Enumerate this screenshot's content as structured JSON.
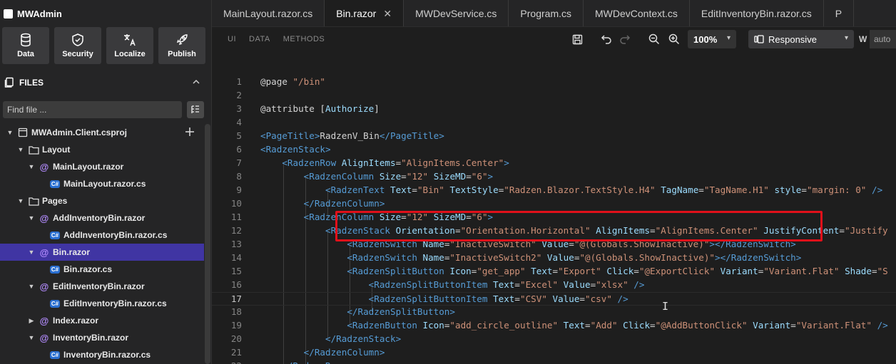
{
  "app": {
    "title": "MWAdmin"
  },
  "quick_actions": [
    {
      "label": "Data",
      "icon": "database-icon"
    },
    {
      "label": "Security",
      "icon": "shield-icon"
    },
    {
      "label": "Localize",
      "icon": "translate-icon"
    },
    {
      "label": "Publish",
      "icon": "rocket-icon"
    }
  ],
  "files": {
    "header": "FILES",
    "search_placeholder": "Find file ...",
    "tree": [
      {
        "label": "MWAdmin.Client.csproj",
        "type": "project",
        "expanded": true,
        "indent": 0
      },
      {
        "label": "Layout",
        "type": "folder",
        "expanded": true,
        "indent": 1
      },
      {
        "label": "MainLayout.razor",
        "type": "razor",
        "expanded": true,
        "indent": 2
      },
      {
        "label": "MainLayout.razor.cs",
        "type": "cs",
        "indent": 3
      },
      {
        "label": "Pages",
        "type": "folder",
        "expanded": true,
        "indent": 1
      },
      {
        "label": "AddInventoryBin.razor",
        "type": "razor",
        "expanded": true,
        "indent": 2
      },
      {
        "label": "AddInventoryBin.razor.cs",
        "type": "cs",
        "indent": 3
      },
      {
        "label": "Bin.razor",
        "type": "razor",
        "expanded": true,
        "indent": 2,
        "selected": true
      },
      {
        "label": "Bin.razor.cs",
        "type": "cs",
        "indent": 3
      },
      {
        "label": "EditInventoryBin.razor",
        "type": "razor",
        "expanded": true,
        "indent": 2
      },
      {
        "label": "EditInventoryBin.razor.cs",
        "type": "cs",
        "indent": 3
      },
      {
        "label": "Index.razor",
        "type": "razor",
        "expanded": false,
        "indent": 2
      },
      {
        "label": "InventoryBin.razor",
        "type": "razor",
        "expanded": true,
        "indent": 2
      },
      {
        "label": "InventoryBin.razor.cs",
        "type": "cs",
        "indent": 3
      }
    ]
  },
  "tabs": [
    {
      "label": "MainLayout.razor.cs",
      "active": false
    },
    {
      "label": "Bin.razor",
      "active": true,
      "closable": true
    },
    {
      "label": "MWDevService.cs",
      "active": false
    },
    {
      "label": "Program.cs",
      "active": false
    },
    {
      "label": "MWDevContext.cs",
      "active": false
    },
    {
      "label": "EditInventoryBin.razor.cs",
      "active": false
    },
    {
      "label": "P",
      "active": false
    }
  ],
  "toolbar": {
    "view_tabs": [
      "UI",
      "DATA",
      "METHODS"
    ],
    "zoom": "100%",
    "device": "Responsive",
    "width_label": "W",
    "width_value": "auto"
  },
  "editor": {
    "current_line": 17,
    "lines": [
      [
        [
          "d",
          "@page "
        ],
        [
          "s",
          "\"/bin\""
        ]
      ],
      [],
      [
        [
          "d",
          "@attribute ["
        ],
        [
          "a",
          "Authorize"
        ],
        [
          "d",
          "]"
        ]
      ],
      [],
      [
        [
          "t",
          "<PageTitle>"
        ],
        [
          "d",
          "RadzenV_Bin"
        ],
        [
          "t",
          "</PageTitle>"
        ]
      ],
      [
        [
          "t",
          "<RadzenStack>"
        ]
      ],
      [
        [
          "d",
          "    "
        ],
        [
          "t",
          "<RadzenRow "
        ],
        [
          "a",
          "AlignItems"
        ],
        [
          "d",
          "="
        ],
        [
          "s",
          "\"AlignItems.Center\""
        ],
        [
          "t",
          ">"
        ]
      ],
      [
        [
          "d",
          "        "
        ],
        [
          "t",
          "<RadzenColumn "
        ],
        [
          "a",
          "Size"
        ],
        [
          "d",
          "="
        ],
        [
          "s",
          "\"12\""
        ],
        [
          "d",
          " "
        ],
        [
          "a",
          "SizeMD"
        ],
        [
          "d",
          "="
        ],
        [
          "s",
          "\"6\""
        ],
        [
          "t",
          ">"
        ]
      ],
      [
        [
          "d",
          "            "
        ],
        [
          "t",
          "<RadzenText "
        ],
        [
          "a",
          "Text"
        ],
        [
          "d",
          "="
        ],
        [
          "s",
          "\"Bin\""
        ],
        [
          "d",
          " "
        ],
        [
          "a",
          "TextStyle"
        ],
        [
          "d",
          "="
        ],
        [
          "s",
          "\"Radzen.Blazor.TextStyle.H4\""
        ],
        [
          "d",
          " "
        ],
        [
          "a",
          "TagName"
        ],
        [
          "d",
          "="
        ],
        [
          "s",
          "\"TagName.H1\""
        ],
        [
          "d",
          " "
        ],
        [
          "a",
          "style"
        ],
        [
          "d",
          "="
        ],
        [
          "s",
          "\"margin: 0\""
        ],
        [
          "d",
          " "
        ],
        [
          "t",
          "/>"
        ]
      ],
      [
        [
          "d",
          "        "
        ],
        [
          "t",
          "</RadzenColumn>"
        ]
      ],
      [
        [
          "d",
          "        "
        ],
        [
          "t",
          "<RadzenColumn "
        ],
        [
          "a",
          "Size"
        ],
        [
          "d",
          "="
        ],
        [
          "s",
          "\"12\""
        ],
        [
          "d",
          " "
        ],
        [
          "a",
          "SizeMD"
        ],
        [
          "d",
          "="
        ],
        [
          "s",
          "\"6\""
        ],
        [
          "t",
          ">"
        ]
      ],
      [
        [
          "d",
          "            "
        ],
        [
          "t",
          "<RadzenStack "
        ],
        [
          "a",
          "Orientation"
        ],
        [
          "d",
          "="
        ],
        [
          "s",
          "\"Orientation.Horizontal\""
        ],
        [
          "d",
          " "
        ],
        [
          "a",
          "AlignItems"
        ],
        [
          "d",
          "="
        ],
        [
          "s",
          "\"AlignItems.Center\""
        ],
        [
          "d",
          " "
        ],
        [
          "a",
          "JustifyContent"
        ],
        [
          "d",
          "="
        ],
        [
          "s",
          "\"Justify"
        ]
      ],
      [
        [
          "d",
          "                "
        ],
        [
          "t",
          "<RadzenSwitch "
        ],
        [
          "a",
          "Name"
        ],
        [
          "d",
          "="
        ],
        [
          "s",
          "\"InactiveSwitch\""
        ],
        [
          "d",
          " "
        ],
        [
          "a",
          "Value"
        ],
        [
          "d",
          "="
        ],
        [
          "s",
          "\"@(Globals.ShowInactive)\""
        ],
        [
          "t",
          "></RadzenSwitch>"
        ]
      ],
      [
        [
          "d",
          "                "
        ],
        [
          "t",
          "<RadzenSwitch "
        ],
        [
          "a",
          "Name"
        ],
        [
          "d",
          "="
        ],
        [
          "s",
          "\"InactiveSwitch2\""
        ],
        [
          "d",
          " "
        ],
        [
          "a",
          "Value"
        ],
        [
          "d",
          "="
        ],
        [
          "s",
          "\"@(Globals.ShowInactive)\""
        ],
        [
          "t",
          "></RadzenSwitch>"
        ]
      ],
      [
        [
          "d",
          "                "
        ],
        [
          "t",
          "<RadzenSplitButton "
        ],
        [
          "a",
          "Icon"
        ],
        [
          "d",
          "="
        ],
        [
          "s",
          "\"get_app\""
        ],
        [
          "d",
          " "
        ],
        [
          "a",
          "Text"
        ],
        [
          "d",
          "="
        ],
        [
          "s",
          "\"Export\""
        ],
        [
          "d",
          " "
        ],
        [
          "a",
          "Click"
        ],
        [
          "d",
          "="
        ],
        [
          "s",
          "\"@ExportClick\""
        ],
        [
          "d",
          " "
        ],
        [
          "a",
          "Variant"
        ],
        [
          "d",
          "="
        ],
        [
          "s",
          "\"Variant.Flat\""
        ],
        [
          "d",
          " "
        ],
        [
          "a",
          "Shade"
        ],
        [
          "d",
          "="
        ],
        [
          "s",
          "\"S"
        ]
      ],
      [
        [
          "d",
          "                    "
        ],
        [
          "t",
          "<RadzenSplitButtonItem "
        ],
        [
          "a",
          "Text"
        ],
        [
          "d",
          "="
        ],
        [
          "s",
          "\"Excel\""
        ],
        [
          "d",
          " "
        ],
        [
          "a",
          "Value"
        ],
        [
          "d",
          "="
        ],
        [
          "s",
          "\"xlsx\""
        ],
        [
          "d",
          " "
        ],
        [
          "t",
          "/>"
        ]
      ],
      [
        [
          "d",
          "                    "
        ],
        [
          "t",
          "<RadzenSplitButtonItem "
        ],
        [
          "a",
          "Text"
        ],
        [
          "d",
          "="
        ],
        [
          "s",
          "\"CSV\""
        ],
        [
          "d",
          " "
        ],
        [
          "a",
          "Value"
        ],
        [
          "d",
          "="
        ],
        [
          "s",
          "\"csv\""
        ],
        [
          "d",
          " "
        ],
        [
          "t",
          "/>"
        ]
      ],
      [
        [
          "d",
          "                "
        ],
        [
          "t",
          "</RadzenSplitButton>"
        ]
      ],
      [
        [
          "d",
          "                "
        ],
        [
          "t",
          "<RadzenButton "
        ],
        [
          "a",
          "Icon"
        ],
        [
          "d",
          "="
        ],
        [
          "s",
          "\"add_circle_outline\""
        ],
        [
          "d",
          " "
        ],
        [
          "a",
          "Text"
        ],
        [
          "d",
          "="
        ],
        [
          "s",
          "\"Add\""
        ],
        [
          "d",
          " "
        ],
        [
          "a",
          "Click"
        ],
        [
          "d",
          "="
        ],
        [
          "s",
          "\"@AddButtonClick\""
        ],
        [
          "d",
          " "
        ],
        [
          "a",
          "Variant"
        ],
        [
          "d",
          "="
        ],
        [
          "s",
          "\"Variant.Flat\""
        ],
        [
          "d",
          " "
        ],
        [
          "t",
          "/>"
        ]
      ],
      [
        [
          "d",
          "            "
        ],
        [
          "t",
          "</RadzenStack>"
        ]
      ],
      [
        [
          "d",
          "        "
        ],
        [
          "t",
          "</RadzenColumn>"
        ]
      ],
      [
        [
          "d",
          "    "
        ],
        [
          "t",
          "</RadzenRow>"
        ]
      ]
    ]
  }
}
